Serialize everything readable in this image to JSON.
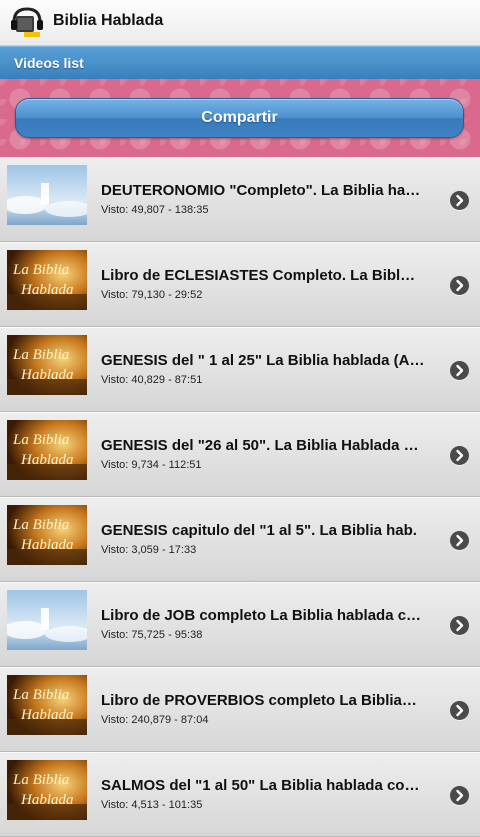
{
  "app": {
    "title": "Biblia Hablada",
    "icon": "headphones-bible-icon"
  },
  "header": {
    "title": "Videos list"
  },
  "share": {
    "label": "Compartir"
  },
  "videos": [
    {
      "title": "DEUTERONOMIO \"Completo\". La Biblia ha…",
      "meta": "Visto: 49,807 - 138:35",
      "thumb": "sky"
    },
    {
      "title": "Libro de ECLESIASTES Completo. La Bibl…",
      "meta": "Visto: 79,130 - 29:52",
      "thumb": "book"
    },
    {
      "title": "GENESIS del \" 1 al 25\" La Biblia hablada (A…",
      "meta": "Visto: 40,829 - 87:51",
      "thumb": "book"
    },
    {
      "title": "GENESIS del \"26 al 50\". La Biblia Hablada …",
      "meta": "Visto: 9,734 - 112:51",
      "thumb": "book"
    },
    {
      "title": "GENESIS capitulo del \"1 al 5\". La Biblia hab.",
      "meta": "Visto: 3,059 - 17:33",
      "thumb": "book"
    },
    {
      "title": "Libro de JOB completo La Biblia hablada c…",
      "meta": "Visto: 75,725 - 95:38",
      "thumb": "sky"
    },
    {
      "title": "Libro de PROVERBIOS completo La Biblia…",
      "meta": "Visto: 240,879 - 87:04",
      "thumb": "book"
    },
    {
      "title": "SALMOS del \"1 al 50\" La Biblia hablada co…",
      "meta": "Visto: 4,513 - 101:35",
      "thumb": "book"
    }
  ],
  "thumb_text": {
    "line1": "La Biblia",
    "line2": "Hablada"
  },
  "colors": {
    "header_blue": "#3a7fbd",
    "band_pink": "#d96a8e",
    "button_blue": "#4b8fd0"
  }
}
